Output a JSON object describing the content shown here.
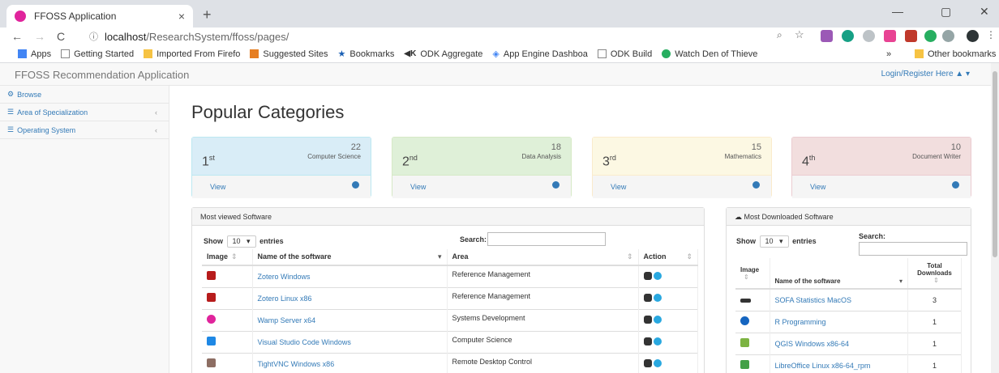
{
  "browser": {
    "tab_title": "FFOSS Application",
    "tab_close": "×",
    "new_tab": "+",
    "url_host": "localhost",
    "url_path": "/ResearchSystem/ffoss/pages/",
    "win_min": "—",
    "win_max": "▢",
    "win_close": "✕"
  },
  "bookmarks": [
    "Apps",
    "Getting Started",
    "Imported From Firefo",
    "Suggested Sites",
    "Bookmarks",
    "ODK Aggregate",
    "App Engine Dashboa",
    "ODK Build",
    "Watch Den of Thieve",
    "»",
    "Other bookmarks"
  ],
  "navbar": {
    "brand": "FFOSS Recommendation Application",
    "login": "Login/Register Here ▲ ▾"
  },
  "sidebar": {
    "items": [
      {
        "label": "Browse",
        "chevron": ""
      },
      {
        "label": "Area of Specialization",
        "chevron": "‹"
      },
      {
        "label": "Operating System",
        "chevron": "‹"
      }
    ]
  },
  "main": {
    "title": "Popular Categories",
    "cards": [
      {
        "rank": "1",
        "sup": "st",
        "count": "22",
        "category": "Computer Science",
        "view": "View"
      },
      {
        "rank": "2",
        "sup": "nd",
        "count": "18",
        "category": "Data Analysis",
        "view": "View"
      },
      {
        "rank": "3",
        "sup": "rd",
        "count": "15",
        "category": "Mathematics",
        "view": "View"
      },
      {
        "rank": "4",
        "sup": "th",
        "count": "10",
        "category": "Document Writer",
        "view": "View"
      }
    ]
  },
  "most_viewed": {
    "heading": "Most viewed Software",
    "show": "Show",
    "entries_value": "10",
    "entries": "entries",
    "search": "Search:",
    "columns": [
      "Image",
      "Name of the software",
      "Area",
      "Action"
    ],
    "rows": [
      {
        "name": "Zotero Windows",
        "area": "Reference Management"
      },
      {
        "name": "Zotero Linux x86",
        "area": "Reference Management"
      },
      {
        "name": "Wamp Server x64",
        "area": "Systems Development"
      },
      {
        "name": "Visual Studio Code Windows",
        "area": "Computer Science"
      },
      {
        "name": "TightVNC Windows x86",
        "area": "Remote Desktop Control"
      }
    ]
  },
  "most_downloaded": {
    "heading": "Most Downloaded Software",
    "show": "Show",
    "entries_value": "10",
    "entries": "entries",
    "search": "Search:",
    "columns": [
      "Image",
      "Name of the software",
      "Total Downloads"
    ],
    "rows": [
      {
        "name": "SOFA Statistics MacOS",
        "downloads": "3"
      },
      {
        "name": "R Programming",
        "downloads": "1"
      },
      {
        "name": "QGIS Windows x86-64",
        "downloads": "1"
      },
      {
        "name": "LibreOffice Linux x86-64_rpm",
        "downloads": "1"
      }
    ]
  },
  "colors": {
    "card1_bg": "#d9edf7",
    "card1_border": "#bce8f1",
    "card2_bg": "#dff0d8",
    "card2_border": "#d6e9c6",
    "card3_bg": "#fcf8e3",
    "card3_border": "#faebcc",
    "card4_bg": "#f2dede",
    "card4_border": "#ebccd1",
    "link": "#337ab7"
  }
}
